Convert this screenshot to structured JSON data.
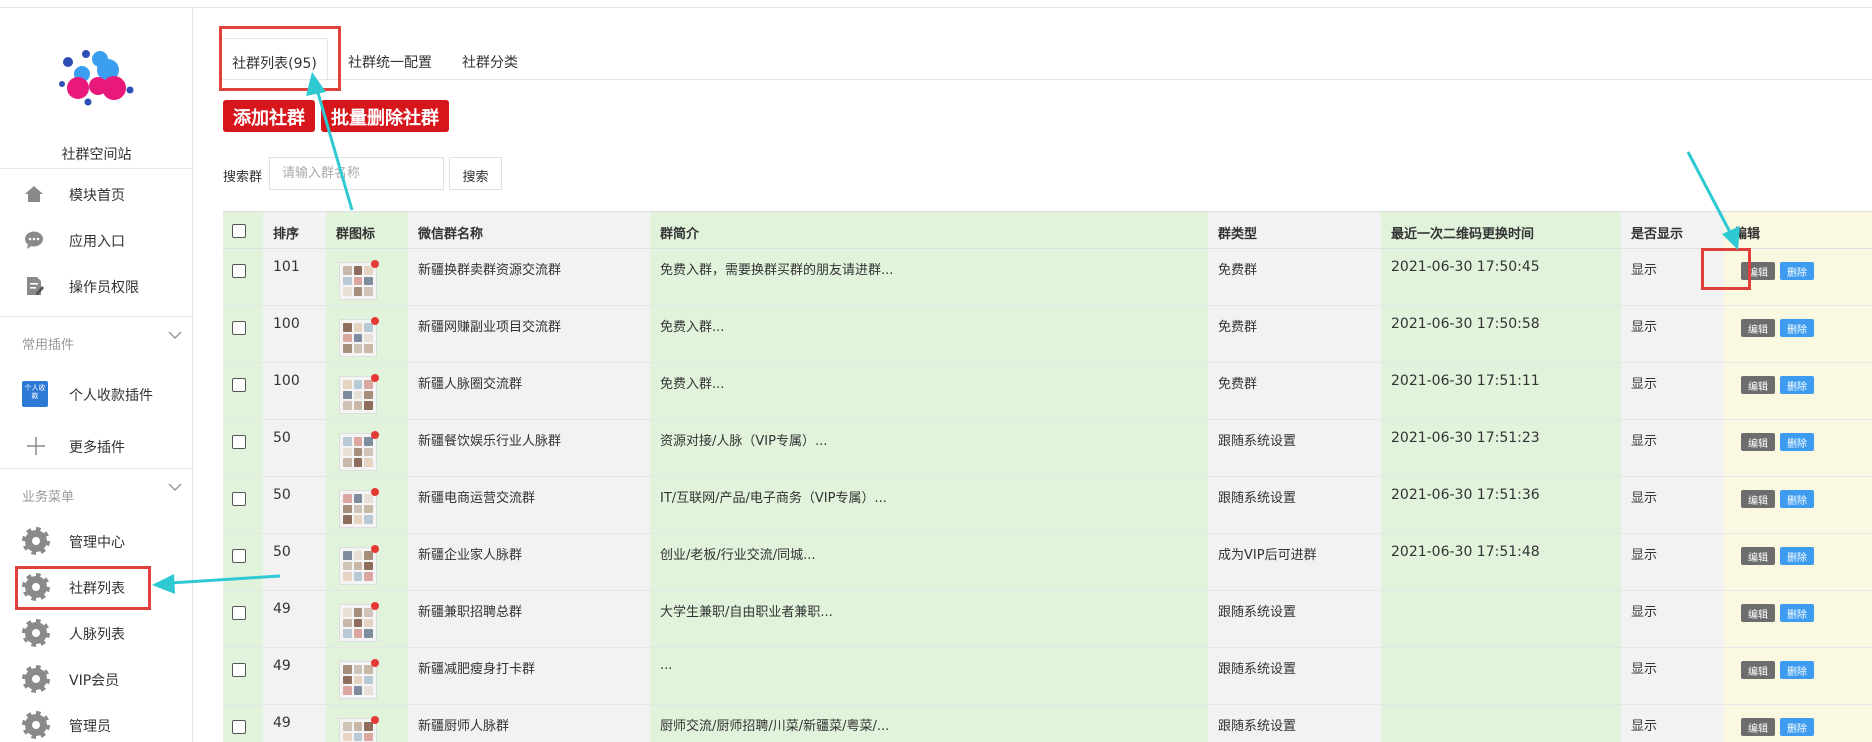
{
  "sidebar": {
    "site_name": "社群空间站",
    "nav_items": [
      {
        "label": "模块首页",
        "icon": "home-icon"
      },
      {
        "label": "应用入口",
        "icon": "chat-bubble-icon"
      },
      {
        "label": "操作员权限",
        "icon": "document-edit-icon"
      }
    ],
    "groups": [
      {
        "title": "常用插件",
        "items": [
          {
            "label": "个人收款插件",
            "icon": "personal-payment-icon",
            "icon_text": "个人收款"
          },
          {
            "label": "更多插件",
            "icon": "plus-icon"
          }
        ]
      },
      {
        "title": "业务菜单",
        "items": [
          {
            "label": "管理中心",
            "icon": "gear-icon"
          },
          {
            "label": "社群列表",
            "icon": "gear-icon"
          },
          {
            "label": "人脉列表",
            "icon": "gear-icon"
          },
          {
            "label": "VIP会员",
            "icon": "gear-icon"
          },
          {
            "label": "管理员",
            "icon": "gear-icon"
          }
        ]
      }
    ]
  },
  "tabs": [
    {
      "label": "社群列表(95)",
      "active": true
    },
    {
      "label": "社群统一配置",
      "active": false
    },
    {
      "label": "社群分类",
      "active": false
    }
  ],
  "actions": {
    "add_label": "添加社群",
    "batch_delete_label": "批量删除社群"
  },
  "search": {
    "label": "搜索群",
    "placeholder": "请输入群名称",
    "value": "",
    "button_label": "搜索"
  },
  "table": {
    "headers": [
      "排序",
      "群图标",
      "微信群名称",
      "群简介",
      "群类型",
      "最近一次二维码更换时间",
      "是否显示",
      "编辑"
    ],
    "rows": [
      {
        "sort": "101",
        "name": "新疆换群卖群资源交流群",
        "intro": "免费入群，需要换群买群的朋友请进群...",
        "type": "免费群",
        "updated": "2021-06-30 17:50:45",
        "visible": "显示"
      },
      {
        "sort": "100",
        "name": "新疆网赚副业项目交流群",
        "intro": "免费入群...",
        "type": "免费群",
        "updated": "2021-06-30 17:50:58",
        "visible": "显示"
      },
      {
        "sort": "100",
        "name": "新疆人脉圈交流群",
        "intro": "免费入群...",
        "type": "免费群",
        "updated": "2021-06-30 17:51:11",
        "visible": "显示"
      },
      {
        "sort": "50",
        "name": "新疆餐饮娱乐行业人脉群",
        "intro": "资源对接/人脉（VIP专属）...",
        "type": "跟随系统设置",
        "updated": "2021-06-30 17:51:23",
        "visible": "显示"
      },
      {
        "sort": "50",
        "name": "新疆电商运营交流群",
        "intro": "IT/互联网/产品/电子商务（VIP专属）...",
        "type": "跟随系统设置",
        "updated": "2021-06-30 17:51:36",
        "visible": "显示"
      },
      {
        "sort": "50",
        "name": "新疆企业家人脉群",
        "intro": "创业/老板/行业交流/同城...",
        "type": "成为VIP后可进群",
        "updated": "2021-06-30 17:51:48",
        "visible": "显示"
      },
      {
        "sort": "49",
        "name": "新疆兼职招聘总群",
        "intro": "大学生兼职/自由职业者兼职...",
        "type": "跟随系统设置",
        "updated": "",
        "visible": "显示"
      },
      {
        "sort": "49",
        "name": "新疆减肥瘦身打卡群",
        "intro": "...",
        "type": "跟随系统设置",
        "updated": "",
        "visible": "显示"
      },
      {
        "sort": "49",
        "name": "新疆厨师人脉群",
        "intro": "厨师交流/厨师招聘/川菜/新疆菜/粤菜/...",
        "type": "跟随系统设置",
        "updated": "",
        "visible": "显示"
      }
    ],
    "edit_label": "编辑",
    "delete_label": "删除"
  },
  "colors": {
    "accent_red": "#d7161c",
    "highlight_red": "#e0403c",
    "arrow_cyan": "#2ec9d2",
    "column_green": "#e2f3dc",
    "column_gray": "#f2f2f2",
    "column_yellow": "#fbf8e2",
    "edit_gray": "#6d6d6d",
    "delete_blue": "#3d9cf0"
  }
}
